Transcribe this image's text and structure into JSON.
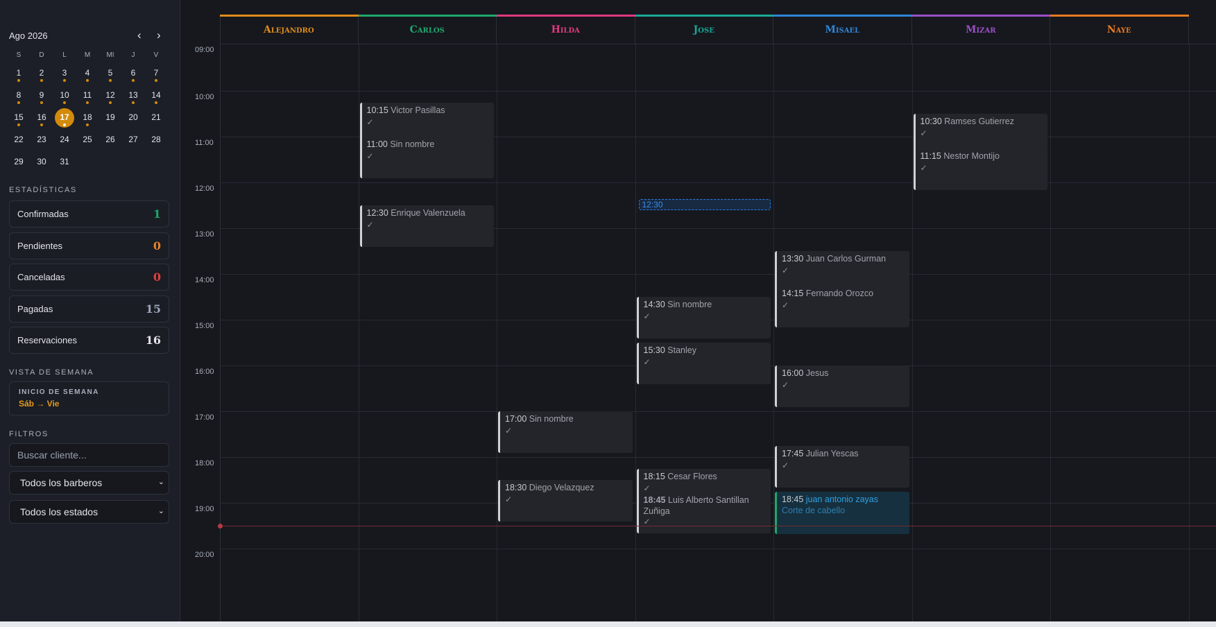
{
  "mini_calendar": {
    "title": "Ago 2026",
    "prev": "‹",
    "next": "›",
    "weekdays": [
      "S",
      "D",
      "L",
      "M",
      "MI",
      "J",
      "V"
    ],
    "weeks": [
      [
        "1",
        "2",
        "3",
        "4",
        "5",
        "6",
        "7"
      ],
      [
        "8",
        "9",
        "10",
        "11",
        "12",
        "13",
        "14"
      ],
      [
        "15",
        "16",
        "17",
        "18",
        "19",
        "20",
        "21"
      ],
      [
        "22",
        "23",
        "24",
        "25",
        "26",
        "27",
        "28"
      ],
      [
        "29",
        "30",
        "31"
      ]
    ],
    "days_with_appointments": [
      "1",
      "2",
      "3",
      "4",
      "5",
      "6",
      "7",
      "8",
      "9",
      "10",
      "11",
      "12",
      "13",
      "14",
      "15",
      "16",
      "17",
      "18"
    ],
    "selected_day": "17",
    "accent_color": "#d48a0a"
  },
  "stats": {
    "title": "ESTADÍSTICAS",
    "items": [
      {
        "label": "Confirmadas",
        "value": "1",
        "color": "#1fa86b"
      },
      {
        "label": "Pendientes",
        "value": "0",
        "color": "#e6812a"
      },
      {
        "label": "Canceladas",
        "value": "0",
        "color": "#e0403c"
      },
      {
        "label": "Pagadas",
        "value": "15",
        "color": "#9aa4b6"
      },
      {
        "label": "Reservaciones",
        "value": "16",
        "color": "#e3e5ea"
      }
    ]
  },
  "week_view": {
    "title": "VISTA DE SEMANA",
    "label": "INICIO DE SEMANA",
    "value": "Sáb → Vie"
  },
  "filters": {
    "title": "FILTROS",
    "search_placeholder": "Buscar cliente...",
    "barber_select": "Todos los barberos",
    "status_select": "Todos los estados"
  },
  "barbers": [
    {
      "name": "Alejandro",
      "color": "#e08c1a"
    },
    {
      "name": "Carlos",
      "color": "#1fa86b"
    },
    {
      "name": "Hilda",
      "color": "#e0397f"
    },
    {
      "name": "Jose",
      "color": "#1aa897"
    },
    {
      "name": "Misael",
      "color": "#2f86d6"
    },
    {
      "name": "Mizar",
      "color": "#9b4fc9"
    },
    {
      "name": "Naye",
      "color": "#e67a22"
    }
  ],
  "hours": [
    "09:00",
    "10:00",
    "11:00",
    "12:00",
    "13:00",
    "14:00",
    "15:00",
    "16:00",
    "17:00",
    "18:00",
    "19:00",
    "20:00"
  ],
  "draft_slot": "12:30",
  "appointments": [
    {
      "barber": 1,
      "time": "10:15",
      "client": "Victor Pasillas",
      "mark": "✓"
    },
    {
      "barber": 1,
      "time": "11:00",
      "client": "Sin nombre",
      "mark": "✓"
    },
    {
      "barber": 1,
      "time": "12:30",
      "client": "Enrique Valenzuela",
      "mark": "✓"
    },
    {
      "barber": 2,
      "time": "17:00",
      "client": "Sin nombre",
      "mark": "✓"
    },
    {
      "barber": 2,
      "time": "18:30",
      "client": "Diego Velazquez",
      "mark": "✓"
    },
    {
      "barber": 3,
      "time": "14:30",
      "client": "Sin nombre",
      "mark": "✓"
    },
    {
      "barber": 3,
      "time": "15:30",
      "client": "Stanley",
      "mark": "✓"
    },
    {
      "barber": 3,
      "time": "18:15",
      "client": "Cesar Flores",
      "mark": "✓"
    },
    {
      "barber": 3,
      "time": "18:45",
      "client": "Luis Alberto Santillan Zuñiga",
      "mark": "✓"
    },
    {
      "barber": 4,
      "time": "13:30",
      "client": "Juan Carlos Gurman",
      "mark": "✓"
    },
    {
      "barber": 4,
      "time": "14:15",
      "client": "Fernando Orozco",
      "mark": "✓"
    },
    {
      "barber": 4,
      "time": "16:00",
      "client": "Jesus",
      "mark": "✓"
    },
    {
      "barber": 4,
      "time": "17:45",
      "client": "Julian Yescas",
      "mark": "✓"
    },
    {
      "barber": 4,
      "time": "18:45",
      "client": "juan antonio zayas",
      "service": "Corte de cabello",
      "status": "confirmed"
    },
    {
      "barber": 5,
      "time": "10:30",
      "client": "Ramses Gutierrez",
      "mark": "✓"
    },
    {
      "barber": 5,
      "time": "11:15",
      "client": "Nestor Montijo",
      "mark": "✓"
    }
  ]
}
